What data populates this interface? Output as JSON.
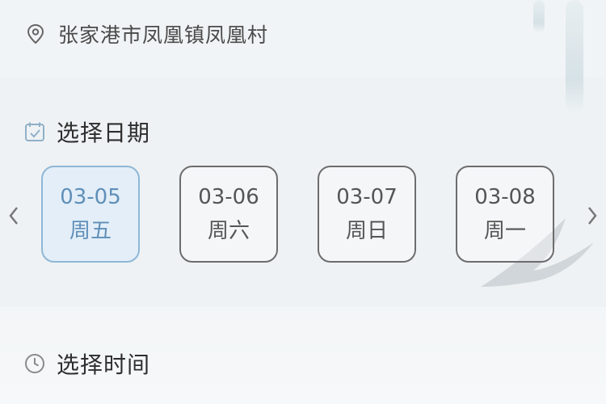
{
  "location": {
    "icon": "map-pin-icon",
    "text": "张家港市凤凰镇凤凰村"
  },
  "date_section": {
    "icon": "calendar-check-icon",
    "title": "选择日期"
  },
  "dates": [
    {
      "date": "03-05",
      "weekday": "周五",
      "selected": true
    },
    {
      "date": "03-06",
      "weekday": "周六",
      "selected": false
    },
    {
      "date": "03-07",
      "weekday": "周日",
      "selected": false
    },
    {
      "date": "03-08",
      "weekday": "周一",
      "selected": false
    }
  ],
  "navigation": {
    "prev_icon": "chevron-left-icon",
    "next_icon": "chevron-right-icon"
  },
  "time_section": {
    "icon": "clock-icon",
    "title": "选择时间"
  },
  "colors": {
    "selected_border": "#8fb7d6",
    "selected_bg": "#e3eef8",
    "selected_text": "#5f8fb8",
    "card_border": "#6d6d6d"
  }
}
